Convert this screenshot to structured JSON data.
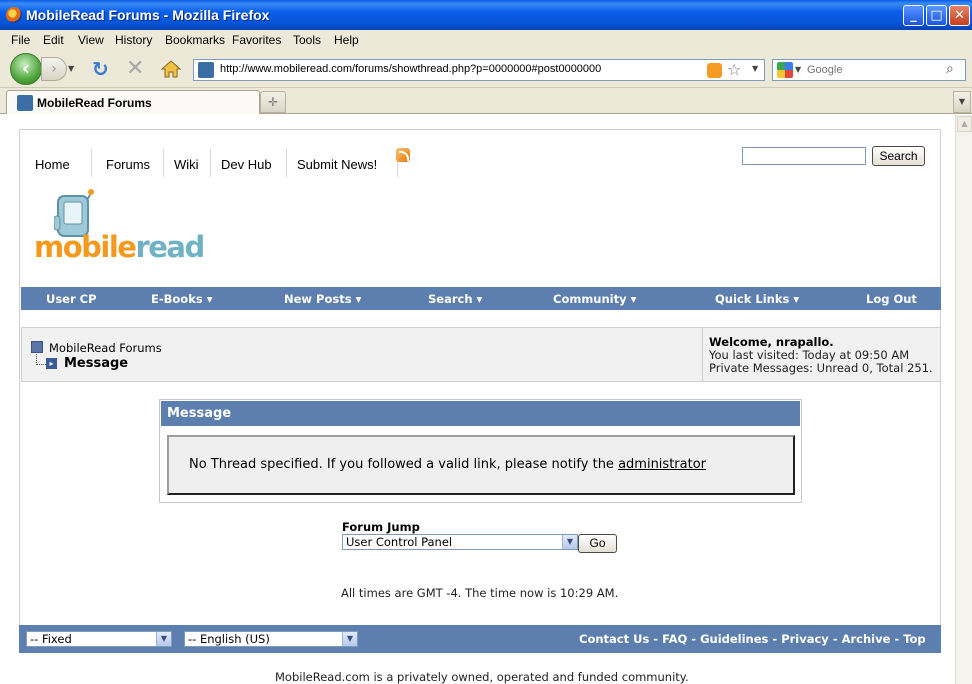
{
  "window": {
    "title": "MobileRead Forums - Mozilla Firefox",
    "min": "_",
    "max": "□",
    "close": "✕"
  },
  "menu": [
    "File",
    "Edit",
    "View",
    "History",
    "Bookmarks",
    "Favorites",
    "Tools",
    "Help"
  ],
  "toolbar": {
    "url": "http://www.mobileread.com/forums/showthread.php?p=0000000#post0000000",
    "search_placeholder": "Google"
  },
  "tabs": [
    {
      "label": "MobileRead Forums"
    }
  ],
  "site": {
    "nav": [
      "Home",
      "Forums",
      "Wiki",
      "Dev Hub",
      "Submit News!"
    ],
    "search_button": "Search",
    "logo_mobile": "mobile",
    "logo_read": "read",
    "bluebar": [
      "User CP",
      "E-Books ▾",
      "New Posts ▾",
      "Search ▾",
      "Community ▾",
      "Quick Links ▾",
      "Log Out"
    ],
    "breadcrumb_root": "MobileRead Forums",
    "breadcrumb_current": "Message",
    "welcome": "Welcome, nrapallo.",
    "last_visited": "You last visited: Today at 09:50 AM",
    "private_messages": "Private Messages: Unread 0, Total 251.",
    "message_title": "Message",
    "message_text": "No Thread specified. If you followed a valid link, please notify the ",
    "message_link": "administrator",
    "forum_jump_label": "Forum Jump",
    "forum_jump_selected": "User Control Panel",
    "go_button": "Go",
    "times": "All times are GMT -4. The time now is 10:29 AM.",
    "style_selected": "-- Fixed",
    "language_selected": "-- English (US)",
    "footer_links": [
      "Contact Us",
      "FAQ",
      "Guidelines",
      "Privacy",
      "Archive",
      "Top"
    ],
    "ownership": "MobileRead.com is a privately owned, operated and funded community."
  },
  "colors": {
    "accent_blue": "#5c7fb0",
    "logo_orange": "#f39a1e",
    "logo_teal": "#6fb2c4"
  }
}
